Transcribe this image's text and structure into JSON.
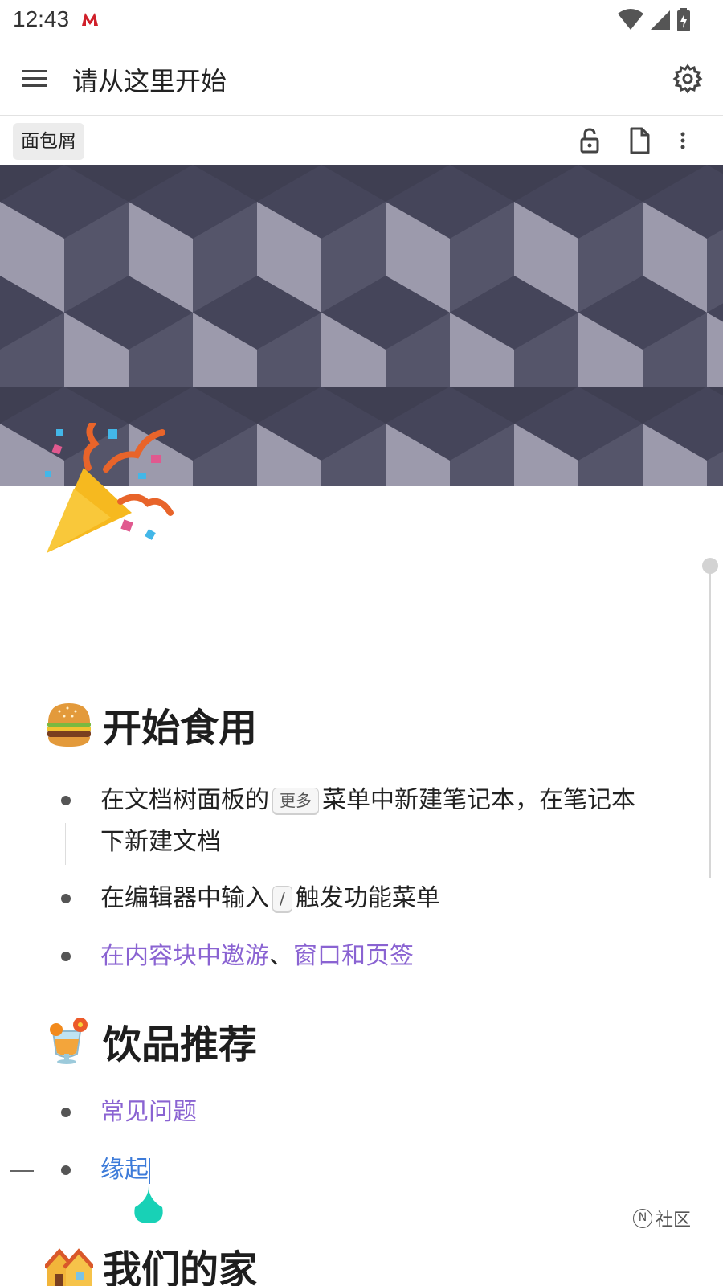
{
  "status_bar": {
    "time": "12:43"
  },
  "app_bar": {
    "title": "请从这里开始"
  },
  "toolbar": {
    "breadcrumb": "面包屑"
  },
  "content": {
    "section1": {
      "heading": "开始食用",
      "items": [
        {
          "part1": "在文档树面板的",
          "kbd": "更多",
          "part2": "菜单中新建笔记本，在笔记本",
          "part3": "下新建文档"
        },
        {
          "part1": "在编辑器中输入",
          "kbd": "/",
          "part2": "触发功能菜单"
        },
        {
          "link1": "在内容块中遨游",
          "sep": "、",
          "link2": "窗口和页签"
        }
      ]
    },
    "section2": {
      "heading": "饮品推荐",
      "items": [
        {
          "link": "常见问题"
        },
        {
          "link": "缘起"
        }
      ]
    },
    "section3": {
      "heading": "我们的家"
    }
  },
  "community": {
    "icon_letter": "N",
    "label": "社区"
  },
  "colors": {
    "link_purple": "#8a63d2",
    "link_blue": "#3d7bd9",
    "drag_handle": "#18d1b6"
  }
}
